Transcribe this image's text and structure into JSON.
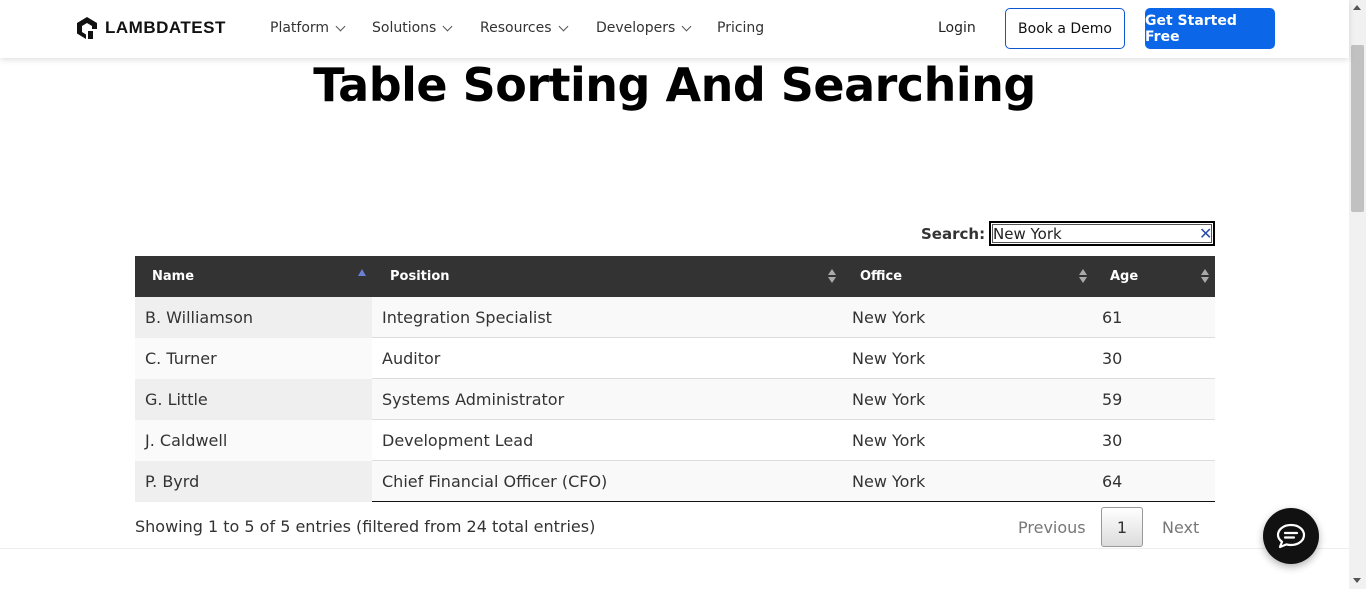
{
  "navbar": {
    "brand": "LAMBDATEST",
    "items": [
      {
        "label": "Platform",
        "has_dropdown": true
      },
      {
        "label": "Solutions",
        "has_dropdown": true
      },
      {
        "label": "Resources",
        "has_dropdown": true
      },
      {
        "label": "Developers",
        "has_dropdown": true
      },
      {
        "label": "Pricing",
        "has_dropdown": false
      }
    ],
    "login": "Login",
    "book_demo": "Book a Demo",
    "get_started": "Get Started Free",
    "accent_color": "#0b67e8"
  },
  "page": {
    "title": "Table Sorting And Searching"
  },
  "search": {
    "label": "Search:",
    "value": "New York"
  },
  "table": {
    "columns": [
      "Name",
      "Position",
      "Office",
      "Age"
    ],
    "sorted_column": "Name",
    "sort_direction": "ascending",
    "rows": [
      {
        "name": "B. Williamson",
        "position": "Integration Specialist",
        "office": "New York",
        "age": "61"
      },
      {
        "name": "C. Turner",
        "position": "Auditor",
        "office": "New York",
        "age": "30"
      },
      {
        "name": "G. Little",
        "position": "Systems Administrator",
        "office": "New York",
        "age": "59"
      },
      {
        "name": "J. Caldwell",
        "position": "Development Lead",
        "office": "New York",
        "age": "30"
      },
      {
        "name": "P. Byrd",
        "position": "Chief Financial Officer (CFO)",
        "office": "New York",
        "age": "64"
      }
    ],
    "info": "Showing 1 to 5 of 5 entries (filtered from 24 total entries)",
    "pagination": {
      "previous": "Previous",
      "current_page": "1",
      "next": "Next"
    }
  },
  "icons": {
    "logo": "lambdatest-logo-icon",
    "clear_search": "close-icon",
    "chat": "chat-bubble-icon"
  }
}
